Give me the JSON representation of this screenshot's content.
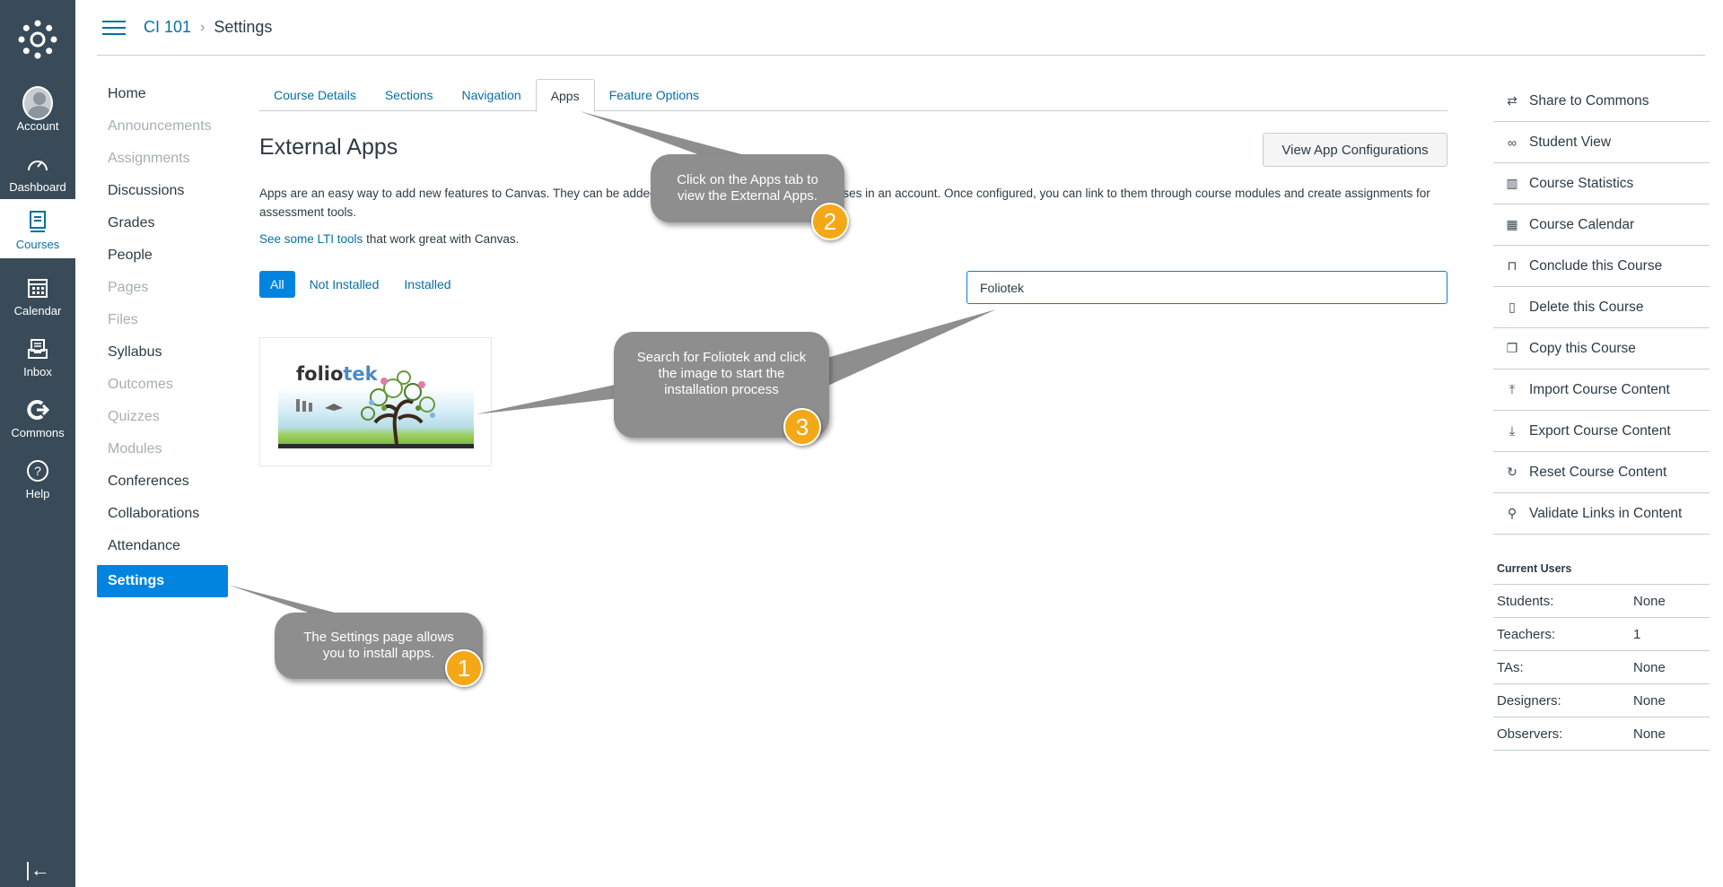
{
  "global_nav": {
    "items": [
      {
        "label": "Account",
        "icon": "avatar-icon"
      },
      {
        "label": "Dashboard",
        "icon": "dashboard-icon"
      },
      {
        "label": "Courses",
        "icon": "courses-icon"
      },
      {
        "label": "Calendar",
        "icon": "calendar-icon"
      },
      {
        "label": "Inbox",
        "icon": "inbox-icon"
      },
      {
        "label": "Commons",
        "icon": "commons-icon"
      },
      {
        "label": "Help",
        "icon": "help-icon"
      }
    ],
    "collapse_glyph": "|←"
  },
  "breadcrumb": {
    "course": "CI 101",
    "separator": "›",
    "current": "Settings"
  },
  "course_nav": {
    "items": [
      {
        "label": "Home"
      },
      {
        "label": "Announcements"
      },
      {
        "label": "Assignments"
      },
      {
        "label": "Discussions"
      },
      {
        "label": "Grades"
      },
      {
        "label": "People"
      },
      {
        "label": "Pages"
      },
      {
        "label": "Files"
      },
      {
        "label": "Syllabus"
      },
      {
        "label": "Outcomes"
      },
      {
        "label": "Quizzes"
      },
      {
        "label": "Modules"
      },
      {
        "label": "Conferences"
      },
      {
        "label": "Collaborations"
      },
      {
        "label": "Attendance"
      },
      {
        "label": "Settings"
      }
    ]
  },
  "tabs": [
    {
      "label": "Course Details"
    },
    {
      "label": "Sections"
    },
    {
      "label": "Navigation"
    },
    {
      "label": "Apps"
    },
    {
      "label": "Feature Options"
    }
  ],
  "main": {
    "title": "External Apps",
    "view_config_label": "View App Configurations",
    "description": "Apps are an easy way to add new features to Canvas. They can be added to individual courses, or to all courses in an account. Once configured, you can link to them through course modules and create assignments for assessment tools.",
    "lti_link": "See some LTI tools",
    "lti_suffix": " that work great with Canvas.",
    "filters": [
      {
        "label": "All"
      },
      {
        "label": "Not Installed"
      },
      {
        "label": "Installed"
      }
    ],
    "search_value": "Foliotek",
    "app": {
      "logo_a": "folio",
      "logo_b": "tek"
    }
  },
  "sidebar": {
    "actions": [
      {
        "label": "Share to Commons",
        "icon": "share-icon",
        "glyph": "⇄"
      },
      {
        "label": "Student View",
        "icon": "glasses-icon",
        "glyph": "∞"
      },
      {
        "label": "Course Statistics",
        "icon": "stats-icon",
        "glyph": "▥"
      },
      {
        "label": "Course Calendar",
        "icon": "calendar-icon",
        "glyph": "▦"
      },
      {
        "label": "Conclude this Course",
        "icon": "lock-icon",
        "glyph": "⊓"
      },
      {
        "label": "Delete this Course",
        "icon": "trash-icon",
        "glyph": "▯"
      },
      {
        "label": "Copy this Course",
        "icon": "copy-icon",
        "glyph": "❐"
      },
      {
        "label": "Import Course Content",
        "icon": "upload-icon",
        "glyph": "⤒"
      },
      {
        "label": "Export Course Content",
        "icon": "download-icon",
        "glyph": "⤓"
      },
      {
        "label": "Reset Course Content",
        "icon": "reset-icon",
        "glyph": "↻"
      },
      {
        "label": "Validate Links in Content",
        "icon": "link-icon",
        "glyph": "⚲"
      }
    ],
    "current_users_title": "Current Users",
    "current_users": [
      {
        "role": "Students:",
        "count": "None"
      },
      {
        "role": "Teachers:",
        "count": "1"
      },
      {
        "role": "TAs:",
        "count": "None"
      },
      {
        "role": "Designers:",
        "count": "None"
      },
      {
        "role": "Observers:",
        "count": "None"
      }
    ]
  },
  "callouts": [
    {
      "text": "The Settings page allows you to install apps.",
      "step": "1"
    },
    {
      "text": "Click on the Apps tab to view the External Apps.",
      "step": "2"
    },
    {
      "text": "Search for Foliotek and click the image to start the installation process",
      "step": "3"
    }
  ],
  "colors": {
    "nav_bg": "#394b58",
    "link": "#0770a3",
    "active": "#0084e0",
    "callout": "#8e8e8e",
    "badge": "#f4a818"
  }
}
